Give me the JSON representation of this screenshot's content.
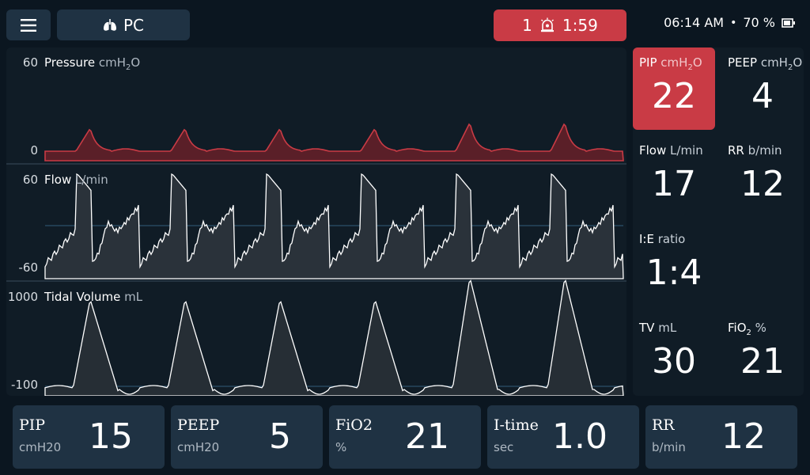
{
  "topbar": {
    "menu_icon": "hamburger-icon",
    "mode_icon": "lungs-icon",
    "mode_label": "PC",
    "alarm": {
      "count": "1",
      "icon": "alarm-bell-icon",
      "timer": "1:59",
      "color": "#c93b45"
    },
    "time": "06:14 AM",
    "separator": "•",
    "battery_percent": "70 %",
    "battery_icon": "battery-icon"
  },
  "waveforms": {
    "pressure": {
      "title": "Pressure",
      "unit_prefix": "cmH",
      "unit_sub": "2",
      "unit_suffix": "O",
      "axis_max": "60",
      "axis_min": "0",
      "color": "#c93b45"
    },
    "flow": {
      "title": "Flow",
      "unit": "L/min",
      "axis_max": "60",
      "axis_min": "-60"
    },
    "volume": {
      "title": "Tidal Volume",
      "unit": "mL",
      "axis_max": "1000",
      "axis_min": "-100"
    }
  },
  "readings": {
    "pip": {
      "label": "PIP",
      "unit_prefix": "cmH",
      "unit_sub": "2",
      "unit_suffix": "O",
      "value": "22",
      "alarmed": true
    },
    "peep": {
      "label": "PEEP",
      "unit_prefix": "cmH",
      "unit_sub": "2",
      "unit_suffix": "O",
      "value": "4"
    },
    "flow": {
      "label": "Flow",
      "unit": "L/min",
      "value": "17"
    },
    "rr": {
      "label": "RR",
      "unit": "b/min",
      "value": "12"
    },
    "ie": {
      "label": "I:E",
      "unit": "ratio",
      "value": "1:4"
    },
    "tv": {
      "label": "TV",
      "unit": "mL",
      "value": "30"
    },
    "fio2": {
      "label_prefix": "FiO",
      "label_sub": "2",
      "unit": "%",
      "value": "21"
    }
  },
  "settings": [
    {
      "name": "PIP",
      "unit": "cmH20",
      "value": "15"
    },
    {
      "name": "PEEP",
      "unit": "cmH20",
      "value": "5"
    },
    {
      "name": "FiO2",
      "unit": "%",
      "value": "21"
    },
    {
      "name": "I-time",
      "unit": "sec",
      "value": "1.0"
    },
    {
      "name": "RR",
      "unit": "b/min",
      "value": "12"
    }
  ]
}
